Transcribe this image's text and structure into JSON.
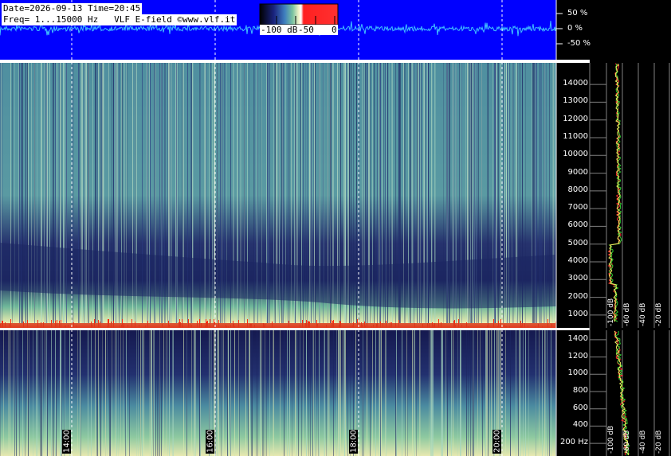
{
  "header": {
    "line1": "Date=2026-09-13 Time=20:45",
    "line2": "Freq= 1...15000 Hz   VLF E-field ©www.vlf.it"
  },
  "colorbar": {
    "labels": [
      "-100 dB",
      "-50",
      "0"
    ],
    "colors": [
      "#000000",
      "#1a237e",
      "#3f7fbf",
      "#7ac3a0",
      "#f4f4c8",
      "#ffffff",
      "#ff0000",
      "#ff3030"
    ]
  },
  "waveform": {
    "labels": [
      "50 %",
      "0 %",
      "-50 %"
    ],
    "background": "#0000ff",
    "trace_color": "#40c0ff"
  },
  "spectrogram_upper": {
    "freq_ticks": [
      "14000",
      "13000",
      "12000",
      "11000",
      "10000",
      "9000",
      "8000",
      "7000",
      "6000",
      "5000",
      "4000",
      "3000",
      "2000",
      "1000"
    ]
  },
  "spectrogram_lower": {
    "freq_ticks": [
      "1400",
      "1200",
      "1000",
      "800",
      "600",
      "400",
      "200 Hz"
    ]
  },
  "time_labels": [
    "14:00",
    "16:00",
    "18:00",
    "20:00"
  ],
  "spectrum_db_labels": [
    "-100 dB",
    "-80 dB",
    "-60 dB",
    "-40 dB",
    "-20 dB"
  ],
  "chart_data": {
    "type": "heatmap",
    "title": "Date=2026-09-13 Time=20:45",
    "subtitle": "Freq= 1...15000 Hz   VLF E-field ©www.vlf.it",
    "x_ticks": [
      "14:00",
      "16:00",
      "18:00",
      "20:00"
    ],
    "y_ticks_upper": [
      14000,
      13000,
      12000,
      11000,
      10000,
      9000,
      8000,
      7000,
      6000,
      5000,
      4000,
      3000,
      2000,
      1000
    ],
    "y_ticks_lower": [
      1400,
      1200,
      1000,
      800,
      600,
      400,
      200
    ],
    "y_unit": "Hz",
    "color_scale_db": [
      -100,
      -50,
      0
    ],
    "quiet_band_hz": [
      1500,
      4000
    ]
  }
}
